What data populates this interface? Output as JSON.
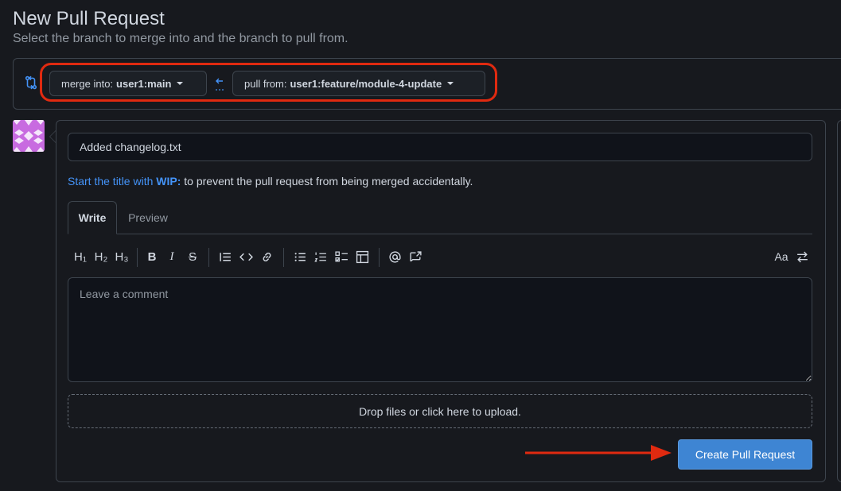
{
  "header": {
    "title": "New Pull Request",
    "subtitle": "Select the branch to merge into and the branch to pull from."
  },
  "branches": {
    "base_prefix": "merge into:",
    "base_value": "user1:main",
    "head_prefix": "pull from:",
    "head_value": "user1:feature/module-4-update"
  },
  "form": {
    "title_value": "Added changelog.txt",
    "hint_link": "Start the title with",
    "hint_keyword": "WIP:",
    "hint_rest": " to prevent the pull request from being merged accidentally.",
    "tabs": [
      "Write",
      "Preview"
    ],
    "toolbar": {
      "h1": "H₁",
      "h2": "H₂",
      "h3": "H₃",
      "bold": "B",
      "italic": "I",
      "strike": "S",
      "aa": "Aa"
    },
    "comment_placeholder": "Leave a comment",
    "dropzone": "Drop files or click here to upload.",
    "submit_label": "Create Pull Request"
  },
  "colors": {
    "accent": "#3e85d3",
    "link": "#4493f8",
    "annotation": "#e02a10",
    "background": "#17191e"
  }
}
